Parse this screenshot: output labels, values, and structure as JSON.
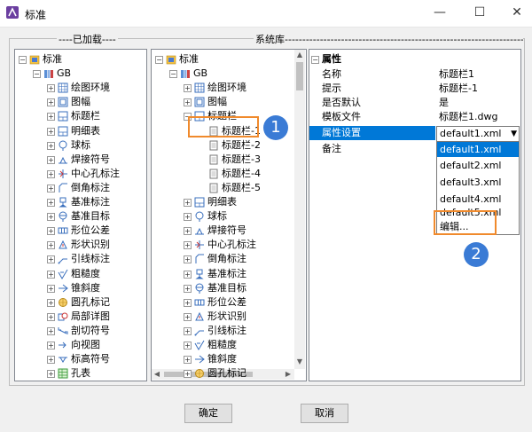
{
  "window": {
    "title": "标准",
    "minimize": "—",
    "maximize": "☐",
    "close": "✕"
  },
  "groups": {
    "loaded_label": "----已加载----",
    "system_label": "系统库--------------------------------------------------------------------------------------------------------"
  },
  "left_tree": [
    {
      "label": "标准",
      "level": 0,
      "icon": "folder-book-icon",
      "expander": "−"
    },
    {
      "label": "GB",
      "level": 1,
      "icon": "library-icon",
      "expander": "−"
    },
    {
      "label": "绘图环境",
      "level": 2,
      "icon": "grid-icon",
      "expander": "+"
    },
    {
      "label": "图幅",
      "level": 2,
      "icon": "frame-icon",
      "expander": "+"
    },
    {
      "label": "标题栏",
      "level": 2,
      "icon": "sheet-icon",
      "expander": "+"
    },
    {
      "label": "明细表",
      "level": 2,
      "icon": "sheet-icon",
      "expander": "+"
    },
    {
      "label": "球标",
      "level": 2,
      "icon": "balloon-icon",
      "expander": "+"
    },
    {
      "label": "焊接符号",
      "level": 2,
      "icon": "weld-icon",
      "expander": "+"
    },
    {
      "label": "中心孔标注",
      "level": 2,
      "icon": "center-hole-icon",
      "expander": "+"
    },
    {
      "label": "倒角标注",
      "level": 2,
      "icon": "chamfer-icon",
      "expander": "+"
    },
    {
      "label": "基准标注",
      "level": 2,
      "icon": "datum-icon",
      "expander": "+"
    },
    {
      "label": "基准目标",
      "level": 2,
      "icon": "datum-target-icon",
      "expander": "+"
    },
    {
      "label": "形位公差",
      "level": 2,
      "icon": "tolerance-icon",
      "expander": "+"
    },
    {
      "label": "形状识别",
      "level": 2,
      "icon": "shape-icon",
      "expander": "+"
    },
    {
      "label": "引线标注",
      "level": 2,
      "icon": "leader-icon",
      "expander": "+"
    },
    {
      "label": "粗糙度",
      "level": 2,
      "icon": "roughness-icon",
      "expander": "+"
    },
    {
      "label": "锥斜度",
      "level": 2,
      "icon": "taper-icon",
      "expander": "+"
    },
    {
      "label": "圆孔标记",
      "level": 2,
      "icon": "hole-mark-icon",
      "expander": "+"
    },
    {
      "label": "局部详图",
      "level": 2,
      "icon": "detail-icon",
      "expander": "+"
    },
    {
      "label": "剖切符号",
      "level": 2,
      "icon": "section-icon",
      "expander": "+"
    },
    {
      "label": "向视图",
      "level": 2,
      "icon": "view-arrow-icon",
      "expander": "+"
    },
    {
      "label": "标高符号",
      "level": 2,
      "icon": "elevation-icon",
      "expander": "+"
    },
    {
      "label": "孔表",
      "level": 2,
      "icon": "hole-table-icon",
      "expander": "+"
    }
  ],
  "mid_tree": [
    {
      "label": "标准",
      "level": 0,
      "icon": "folder-book-icon",
      "expander": "−"
    },
    {
      "label": "GB",
      "level": 1,
      "icon": "library-icon",
      "expander": "−"
    },
    {
      "label": "绘图环境",
      "level": 2,
      "icon": "grid-icon",
      "expander": "+"
    },
    {
      "label": "图幅",
      "level": 2,
      "icon": "frame-icon",
      "expander": "+"
    },
    {
      "label": "标题栏",
      "level": 2,
      "icon": "sheet-icon",
      "expander": "−"
    },
    {
      "label": "标题栏-1",
      "level": 3,
      "icon": "doc-icon",
      "expander": ""
    },
    {
      "label": "标题栏-2",
      "level": 3,
      "icon": "doc-icon",
      "expander": ""
    },
    {
      "label": "标题栏-3",
      "level": 3,
      "icon": "doc-icon",
      "expander": ""
    },
    {
      "label": "标题栏-4",
      "level": 3,
      "icon": "doc-icon",
      "expander": ""
    },
    {
      "label": "标题栏-5",
      "level": 3,
      "icon": "doc-icon",
      "expander": ""
    },
    {
      "label": "明细表",
      "level": 2,
      "icon": "sheet-icon",
      "expander": "+"
    },
    {
      "label": "球标",
      "level": 2,
      "icon": "balloon-icon",
      "expander": "+"
    },
    {
      "label": "焊接符号",
      "level": 2,
      "icon": "weld-icon",
      "expander": "+"
    },
    {
      "label": "中心孔标注",
      "level": 2,
      "icon": "center-hole-icon",
      "expander": "+"
    },
    {
      "label": "倒角标注",
      "level": 2,
      "icon": "chamfer-icon",
      "expander": "+"
    },
    {
      "label": "基准标注",
      "level": 2,
      "icon": "datum-icon",
      "expander": "+"
    },
    {
      "label": "基准目标",
      "level": 2,
      "icon": "datum-target-icon",
      "expander": "+"
    },
    {
      "label": "形位公差",
      "level": 2,
      "icon": "tolerance-icon",
      "expander": "+"
    },
    {
      "label": "形状识别",
      "level": 2,
      "icon": "shape-icon",
      "expander": "+"
    },
    {
      "label": "引线标注",
      "level": 2,
      "icon": "leader-icon",
      "expander": "+"
    },
    {
      "label": "粗糙度",
      "level": 2,
      "icon": "roughness-icon",
      "expander": "+"
    },
    {
      "label": "锥斜度",
      "level": 2,
      "icon": "taper-icon",
      "expander": "+"
    },
    {
      "label": "圆孔标记",
      "level": 2,
      "icon": "hole-mark-icon",
      "expander": "+"
    }
  ],
  "properties": {
    "header": "属性",
    "header_expander": "−",
    "rows": [
      {
        "name": "名称",
        "value": "标题栏1"
      },
      {
        "name": "提示",
        "value": "标题栏-1"
      },
      {
        "name": "是否默认",
        "value": "是"
      },
      {
        "name": "模板文件",
        "value": "标题栏1.dwg"
      },
      {
        "name": "属性设置",
        "value": "default1.xml"
      },
      {
        "name": "备注",
        "value": ""
      }
    ],
    "dropdown_options": [
      "default1.xml",
      "default2.xml",
      "default3.xml",
      "default4.xml",
      "default5.xml",
      "编辑..."
    ]
  },
  "buttons": {
    "ok": "确定",
    "cancel": "取消"
  },
  "callouts": [
    "1",
    "2"
  ],
  "colors": {
    "selection": "#0078d7",
    "callout_border": "#f08a2c",
    "badge": "#3a7bd5"
  }
}
